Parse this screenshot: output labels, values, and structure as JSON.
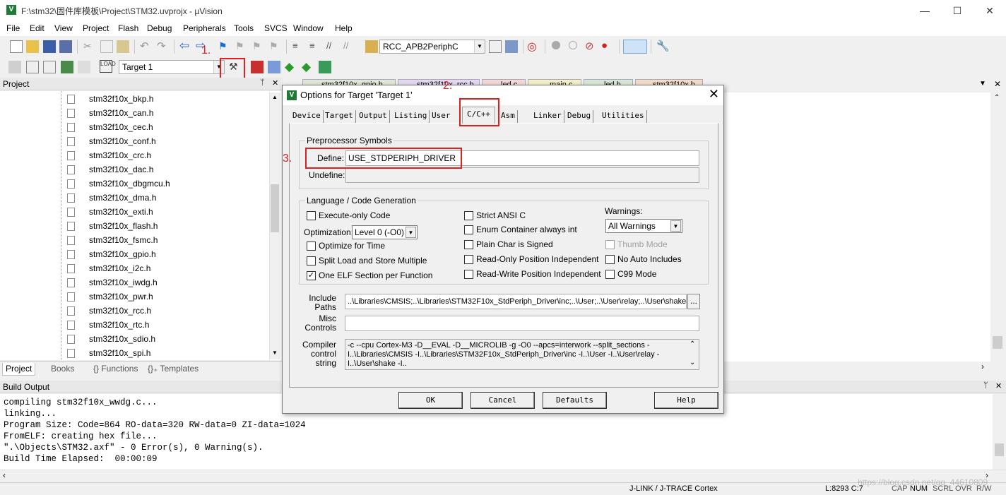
{
  "window": {
    "title": "F:\\stm32\\固件库模板\\Project\\STM32.uvprojx - µVision",
    "minimize": "—",
    "maximize": "☐",
    "close": "✕"
  },
  "menu": [
    "File",
    "Edit",
    "View",
    "Project",
    "Flash",
    "Debug",
    "Peripherals",
    "Tools",
    "SVCS",
    "Window",
    "Help"
  ],
  "toolbar": {
    "function_combo": "RCC_APB2PeriphC",
    "target_combo": "Target 1"
  },
  "annotations": {
    "step1": "1.",
    "step2": "2.",
    "step3": "3."
  },
  "project_panel": {
    "title": "Project",
    "pin": "ᛘ",
    "close": "✕",
    "files": [
      "stm32f10x_bkp.h",
      "stm32f10x_can.h",
      "stm32f10x_cec.h",
      "stm32f10x_conf.h",
      "stm32f10x_crc.h",
      "stm32f10x_dac.h",
      "stm32f10x_dbgmcu.h",
      "stm32f10x_dma.h",
      "stm32f10x_exti.h",
      "stm32f10x_flash.h",
      "stm32f10x_fsmc.h",
      "stm32f10x_gpio.h",
      "stm32f10x_i2c.h",
      "stm32f10x_iwdg.h",
      "stm32f10x_pwr.h",
      "stm32f10x_rcc.h",
      "stm32f10x_rtc.h",
      "stm32f10x_sdio.h",
      "stm32f10x_spi.h"
    ],
    "tabs": [
      "Project",
      "Books",
      "{} Functions",
      "{}₊ Templates"
    ]
  },
  "editor_tabs": [
    "stm32f10x_gpio.h",
    "stm32f10x_rcc.h",
    "led.c",
    "main.c",
    "led.h",
    "stm32f10x.h"
  ],
  "dialog": {
    "title": "Options for Target 'Target 1'",
    "close": "✕",
    "tabs": [
      "Device",
      "Target",
      "Output",
      "Listing",
      "User",
      "C/C++",
      "Asm",
      "Linker",
      "Debug",
      "Utilities"
    ],
    "active_tab": "C/C++",
    "preprocessor": {
      "group_title": "Preprocessor Symbols",
      "define_label": "Define:",
      "define_value": "USE_STDPERIPH_DRIVER",
      "undefine_label": "Undefine:",
      "undefine_value": ""
    },
    "language": {
      "group_title": "Language / Code Generation",
      "execute_only": {
        "label": "Execute-only Code",
        "checked": false
      },
      "optimization_label": "Optimization:",
      "optimization_value": "Level 0 (-O0)",
      "optimize_time": {
        "label": "Optimize for Time",
        "checked": false
      },
      "split_load": {
        "label": "Split Load and Store Multiple",
        "checked": false
      },
      "one_elf": {
        "label": "One ELF Section per Function",
        "checked": true
      },
      "strict_ansi": {
        "label": "Strict ANSI C",
        "checked": false
      },
      "enum_container": {
        "label": "Enum Container always int",
        "checked": false
      },
      "plain_char": {
        "label": "Plain Char is Signed",
        "checked": false
      },
      "ro_pi": {
        "label": "Read-Only Position Independent",
        "checked": false
      },
      "rw_pi": {
        "label": "Read-Write Position Independent",
        "checked": false
      },
      "warnings_label": "Warnings:",
      "warnings_value": "All Warnings",
      "thumb_mode": {
        "label": "Thumb Mode",
        "checked": false
      },
      "no_auto_includes": {
        "label": "No Auto Includes",
        "checked": false
      },
      "c99_mode": {
        "label": "C99 Mode",
        "checked": false
      }
    },
    "include_paths_label": "Include\nPaths",
    "include_paths_value": "..\\Libraries\\CMSIS;..\\Libraries\\STM32F10x_StdPeriph_Driver\\inc;..\\User;..\\User\\relay;..\\User\\shake",
    "browse_label": "...",
    "misc_controls_label": "Misc\nControls",
    "misc_controls_value": "",
    "compiler_label": "Compiler\ncontrol\nstring",
    "compiler_value": "-c --cpu Cortex-M3 -D__EVAL -D__MICROLIB -g -O0 --apcs=interwork --split_sections -I..\\Libraries\\CMSIS -I..\\Libraries\\STM32F10x_StdPeriph_Driver\\inc -I..\\User -I..\\User\\relay -I..\\User\\shake -I..",
    "buttons": {
      "ok": "OK",
      "cancel": "Cancel",
      "defaults": "Defaults",
      "help": "Help"
    }
  },
  "build_output": {
    "title": "Build Output",
    "lines": [
      "compiling stm32f10x_wwdg.c...",
      "linking...",
      "Program Size: Code=864 RO-data=320 RW-data=0 ZI-data=1024",
      "FromELF: creating hex file...",
      "\".\\Objects\\STM32.axf\" - 0 Error(s), 0 Warning(s).",
      "Build Time Elapsed:  00:00:09"
    ]
  },
  "statusbar": {
    "debugger": "J-LINK / J-TRACE Cortex",
    "position": "L:8293 C:7",
    "cap": "CAP",
    "num": "NUM",
    "scrl": "SCRL",
    "ovr": "OVR",
    "rw": "R/W",
    "watermark": "https://blog.csdn.net/qq_44610809"
  },
  "colors": {
    "annotation_red": "#e02020",
    "keil_green": "#1e7a36"
  }
}
